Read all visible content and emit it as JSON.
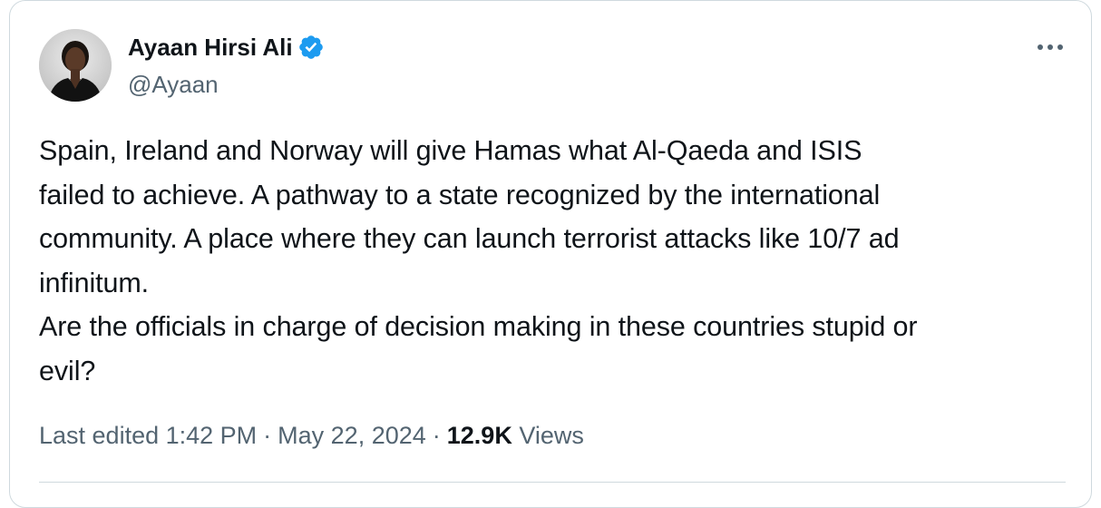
{
  "author": {
    "display_name": "Ayaan Hirsi Ali",
    "handle": "@Ayaan",
    "verified_icon": "verified-badge-icon",
    "verified_color": "#1d9bf0"
  },
  "tweet": {
    "text": "Spain, Ireland and Norway will give Hamas what Al-Qaeda and ISIS\nfailed to achieve. A pathway to a state recognized by the international\ncommunity. A place where they can launch terrorist attacks like 10/7 ad\ninfinitum.\nAre the officials in charge of decision making in these countries stupid or\nevil?"
  },
  "meta": {
    "edited_label": "Last edited 1:42 PM",
    "separator": "·",
    "date": "May 22, 2024",
    "views_count": "12.9K",
    "views_label": "Views"
  },
  "colors": {
    "text": "#0f1419",
    "secondary": "#536471",
    "border": "#cfd9de"
  }
}
